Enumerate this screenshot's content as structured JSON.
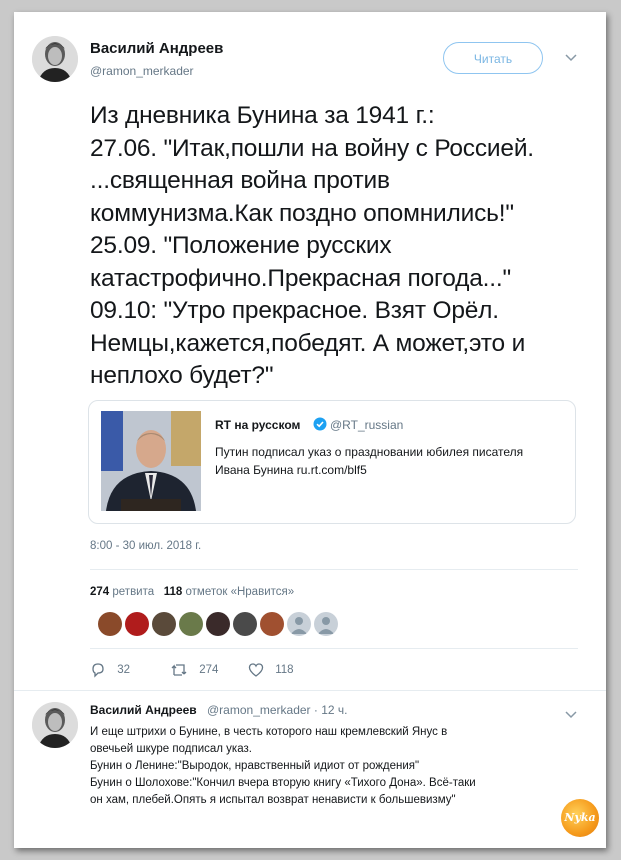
{
  "tweet": {
    "author_name": "Василий Андреев",
    "author_handle": "@ramon_merkader",
    "follow_label": "Читать",
    "text": "Из дневника Бунина за 1941 г.:\n27.06. \"Итак,пошли на войну с Россией.\n...священная война против\nкоммунизма.Как поздно опомнились!\"\n25.09. \"Положение русских\nкатастрофично.Прекрасная погода...\"\n09.10: \"Утро прекрасное. Взят Орёл.\nНемцы,кажется,победят. А может,это и\nнеплохо будет?\"",
    "timestamp": "8:00 - 30 июл. 2018 г.",
    "retweets_count": "274",
    "retweets_label": "ретвита",
    "likes_count": "118",
    "likes_label": "отметок «Нравится»",
    "replies": "32",
    "retweets": "274",
    "likes": "118"
  },
  "quoted": {
    "name": "RT на русском",
    "handle": "@RT_russian",
    "text": "Путин подписал указ о праздновании юбилея писателя Ивана Бунина ru.rt.com/blf5"
  },
  "reply": {
    "author_name": "Василий Андреев",
    "meta": "@ramon_merkader · 12 ч.",
    "lines": [
      "И еще штрихи о Бунине, в честь которого наш кремлевский Янус в",
      "овечьей шкуре подписал указ.",
      "Бунин о Ленине:\"Выродок, нравственный идиот от рождения\"",
      "Бунин о Шолохове:\"Кончил вчера вторую книгу «Тихого Дона». Всё-таки",
      "он хам, плебей.Опять я испытал возврат ненависти к большевизму\""
    ]
  },
  "watermark": "Nyka",
  "colors": {
    "link": "#1da1f2",
    "muted": "#657786",
    "verified": "#1da1f2"
  }
}
